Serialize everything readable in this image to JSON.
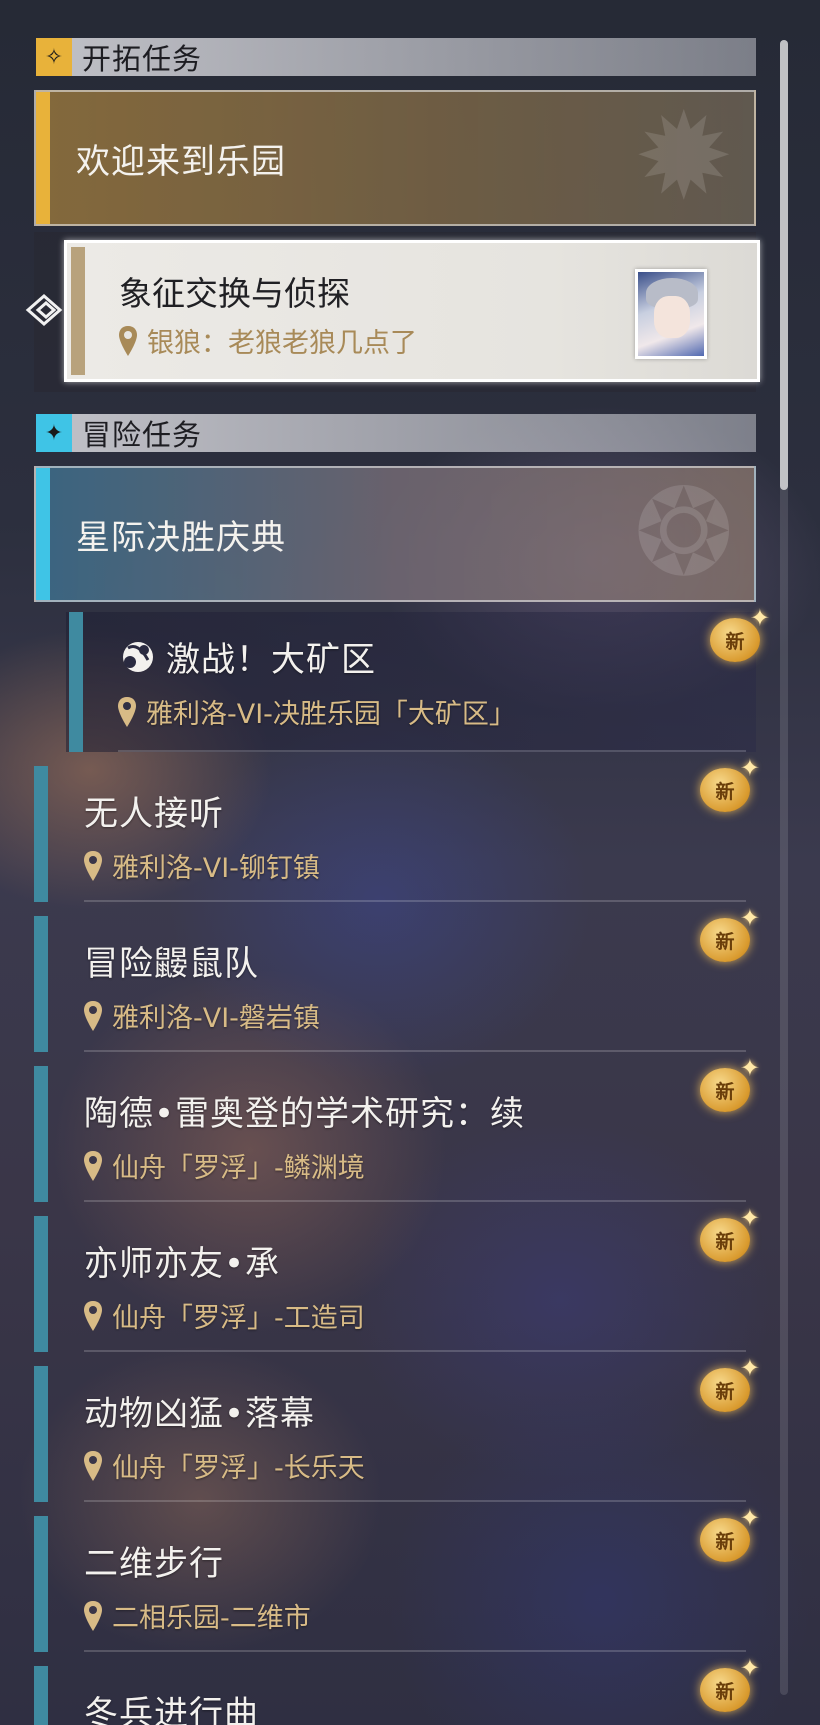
{
  "sections": {
    "trailblaze": {
      "title": "开拓任务"
    },
    "adventure": {
      "title": "冒险任务"
    }
  },
  "trailblaze_main": {
    "title": "欢迎来到乐园"
  },
  "tracked_quest": {
    "title": "象征交换与侦探",
    "location": "银狼：老狼老狼几点了"
  },
  "adventure_main": {
    "title": "星际决胜庆典"
  },
  "adventure_sub": {
    "title": "激战！大矿区",
    "location": "雅利洛-VI-决胜乐园「大矿区」",
    "badge": "新"
  },
  "quests": [
    {
      "title": "无人接听",
      "location": "雅利洛-VI-铆钉镇",
      "badge": "新"
    },
    {
      "title": "冒险鼹鼠队",
      "location": "雅利洛-VI-磐岩镇",
      "badge": "新"
    },
    {
      "title": "陶德•雷奥登的学术研究：续",
      "location": "仙舟「罗浮」-鳞渊境",
      "badge": "新"
    },
    {
      "title": "亦师亦友•承",
      "location": "仙舟「罗浮」-工造司",
      "badge": "新"
    },
    {
      "title": "动物凶猛•落幕",
      "location": "仙舟「罗浮」-长乐天",
      "badge": "新"
    },
    {
      "title": "二维步行",
      "location": "二相乐园-二维市",
      "badge": "新"
    },
    {
      "title": "冬兵进行曲",
      "location": "",
      "badge": "新"
    }
  ],
  "colors": {
    "trailblaze_accent": "#e8b23a",
    "adventure_accent": "#3fc4e6",
    "quest_accent": "#3f8aa0",
    "location_text": "#d8bb86",
    "badge": "#d99a2e"
  },
  "icons": {
    "trailblaze_section": "diamond-sparkle-icon",
    "adventure_section": "star-sparkle-icon",
    "location": "map-pin-icon",
    "tracking": "track-arrow-icon",
    "event": "event-swirl-icon"
  }
}
